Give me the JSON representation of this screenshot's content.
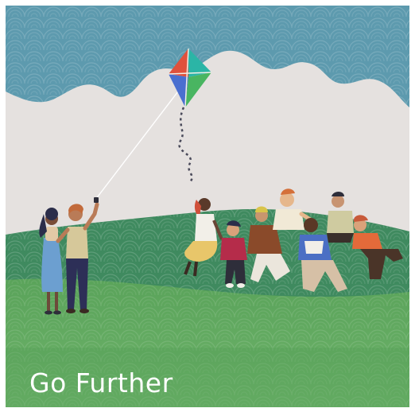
{
  "card": {
    "caption": "Go Further"
  },
  "colors": {
    "sky": "#5d9aae",
    "cloud": "#e5e1df",
    "hill_back": "#3f8a5f",
    "hill_front": "#5aa35a",
    "kite_red": "#e0513c",
    "kite_blue": "#4a6fd0",
    "kite_green": "#49b561",
    "kite_teal": "#2bb5a6",
    "caption_text": "#ffffff"
  },
  "illustration": {
    "scene": "kite-flying-picnic",
    "icons": [
      "kite-icon",
      "people-group-icon"
    ]
  }
}
